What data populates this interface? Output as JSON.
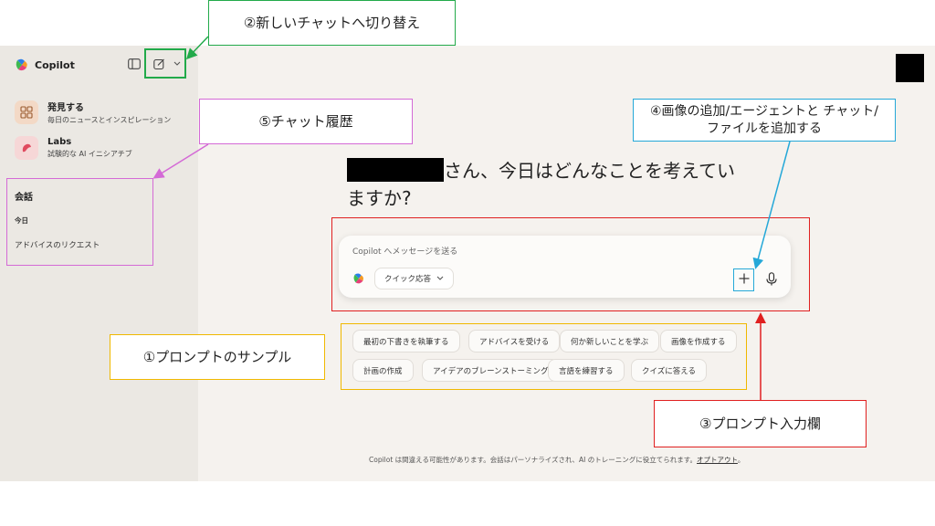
{
  "app": {
    "name": "Copilot"
  },
  "sidebar": {
    "items": [
      {
        "title": "発見する",
        "subtitle": "毎日のニュースとインスピレーション",
        "icon": "discover-grid-icon"
      },
      {
        "title": "Labs",
        "subtitle": "試験的な AI イニシアチブ",
        "icon": "labs-flask-icon"
      }
    ],
    "conversations_header": "会話",
    "today_label": "今日",
    "conversations": [
      "アドバイスのリクエスト"
    ]
  },
  "main": {
    "greeting": "さん、今日はどんなことを考えていますか?",
    "composer": {
      "placeholder": "Copilot へメッセージを送る",
      "mode_label": "クイック応答"
    },
    "suggestions": [
      "最初の下書きを執筆する",
      "アドバイスを受ける",
      "何か新しいことを学ぶ",
      "画像を作成する",
      "計画の作成",
      "アイデアのブレーンストーミング",
      "言語を練習する",
      "クイズに答える"
    ],
    "footer_text": "Copilot は間違える可能性があります。会話はパーソナライズされ、AI のトレーニングに役立てられます。",
    "footer_link": "オプトアウト",
    "footer_end": "。"
  },
  "annotations": {
    "new_chat": "②新しいチャットへ切り替え",
    "history": "⑤チャット履歴",
    "add": "④画像の追加/エージェントと チャット/ファイルを追加する",
    "samples": "①プロンプトのサンプル",
    "input": "③プロンプト入力欄"
  },
  "colors": {
    "annotation_new_chat": "#22aa4a",
    "annotation_history": "#d46ad6",
    "annotation_add": "#25a8d8",
    "annotation_samples": "#f0b800",
    "annotation_input": "#e02020"
  }
}
